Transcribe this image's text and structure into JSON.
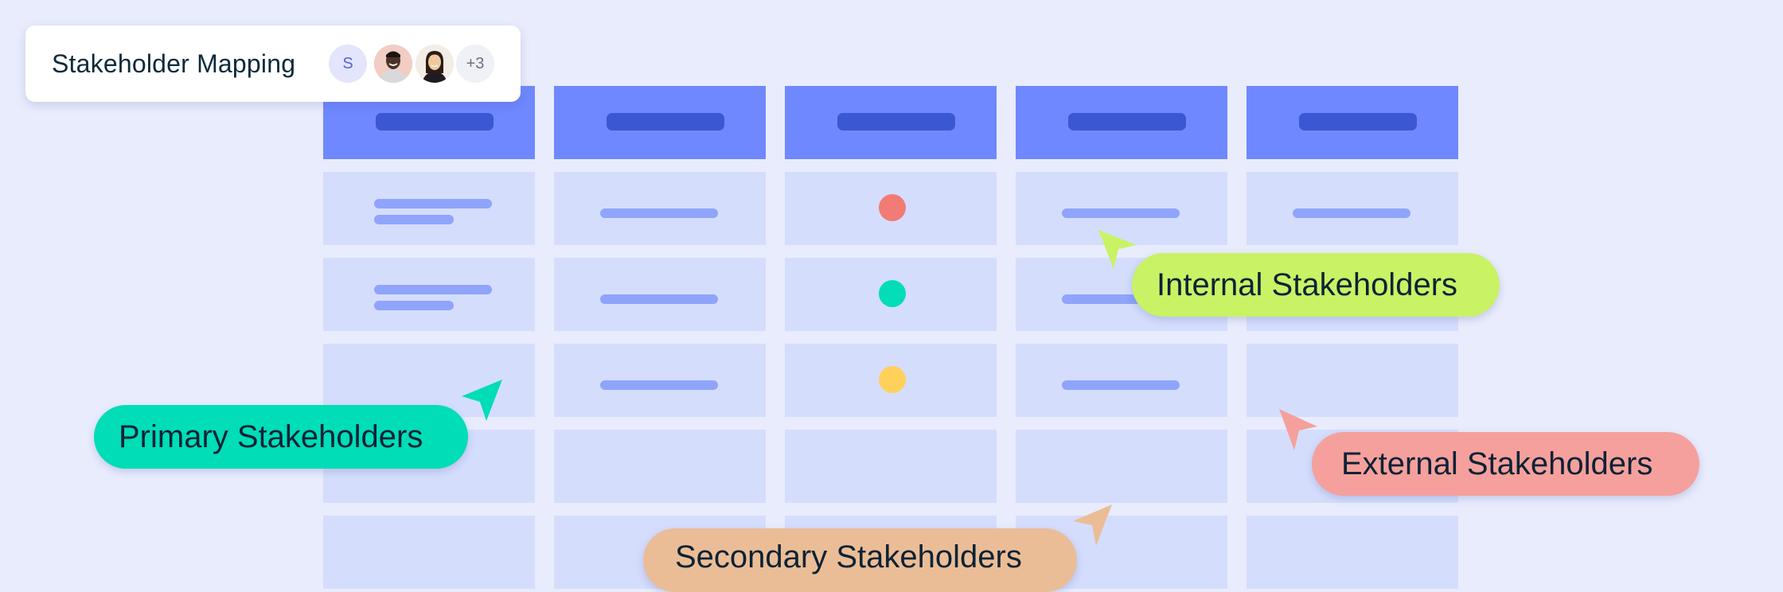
{
  "board": {
    "title": "Stakeholder Mapping",
    "collaborators": [
      {
        "type": "initial",
        "label": "S",
        "name": "collaborator-s"
      },
      {
        "type": "photo",
        "name": "collaborator-photo-1"
      },
      {
        "type": "photo",
        "name": "collaborator-photo-2"
      },
      {
        "type": "more",
        "label": "+3"
      }
    ]
  },
  "table": {
    "columns": 5,
    "rows": 5,
    "cells": [
      [
        "two-lines",
        "line",
        "dot:red",
        "line",
        "line"
      ],
      [
        "two-lines",
        "line",
        "dot:green",
        "line",
        "empty"
      ],
      [
        "empty",
        "line",
        "dot:yellow",
        "line",
        "empty"
      ],
      [
        "empty",
        "empty",
        "empty",
        "empty",
        "empty"
      ],
      [
        "empty",
        "empty",
        "empty",
        "empty",
        "empty"
      ]
    ]
  },
  "colors": {
    "background": "#e9ecfd",
    "header": "#6f88ff",
    "header_pill": "#3b57d4",
    "cell": "#d5ddfd",
    "line": "#8fa4fb",
    "dot_red": "#f27b75",
    "dot_green": "#00ddb7",
    "dot_yellow": "#ffd15b"
  },
  "callouts": [
    {
      "id": "primary",
      "label": "Primary Stakeholders",
      "color": "#00ddb7"
    },
    {
      "id": "internal",
      "label": "Internal Stakeholders",
      "color": "#c9f264"
    },
    {
      "id": "external",
      "label": "External Stakeholders",
      "color": "#f5a09c"
    },
    {
      "id": "secondary",
      "label": "Secondary Stakeholders",
      "color": "#ebbd96"
    }
  ]
}
